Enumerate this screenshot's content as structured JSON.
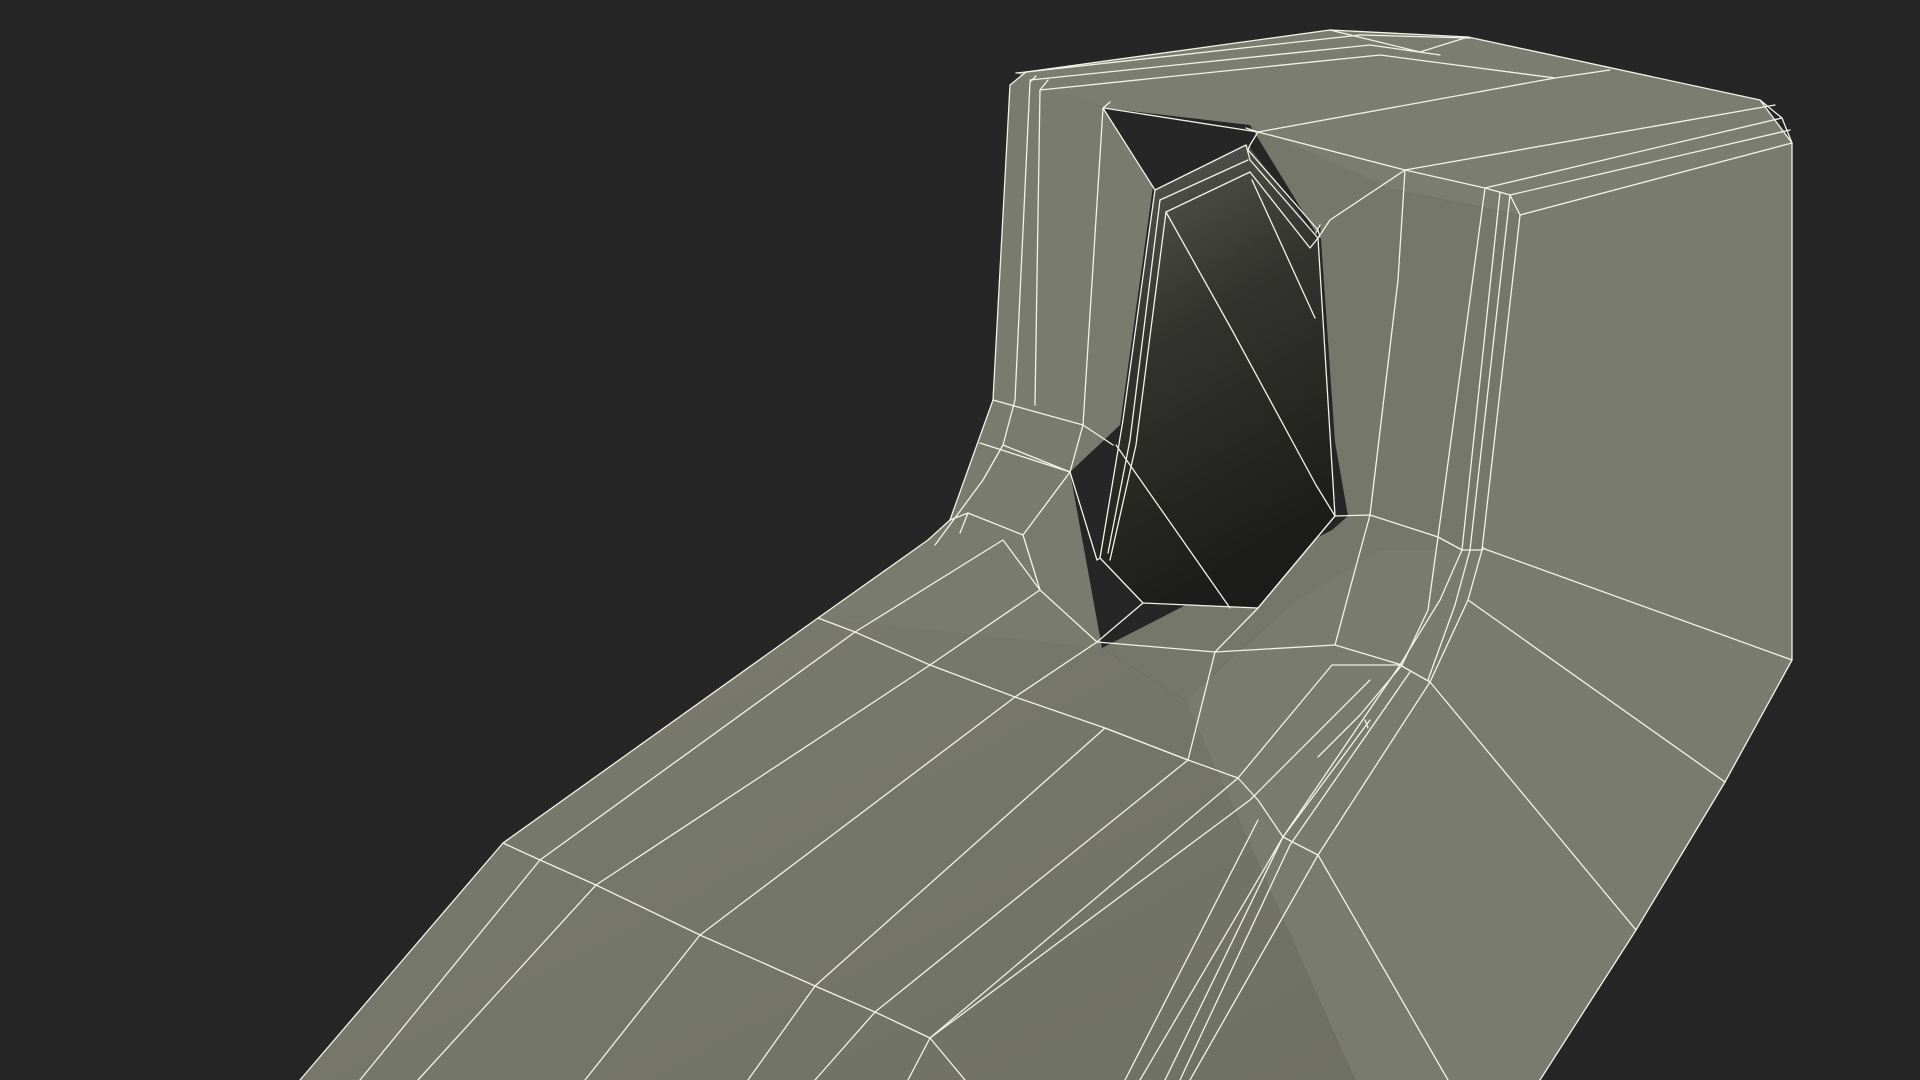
{
  "scene": {
    "subject": "wireframe-3d-mesh",
    "colors": {
      "background": "#262626",
      "surface_light": "#7b7c70",
      "surface_mid": "#74756a",
      "surface_dark": "#6b6c61",
      "hole_top": "#5a5b53",
      "hole_bottom": "#1e1f1b",
      "edge": "#f2f2e6"
    }
  }
}
